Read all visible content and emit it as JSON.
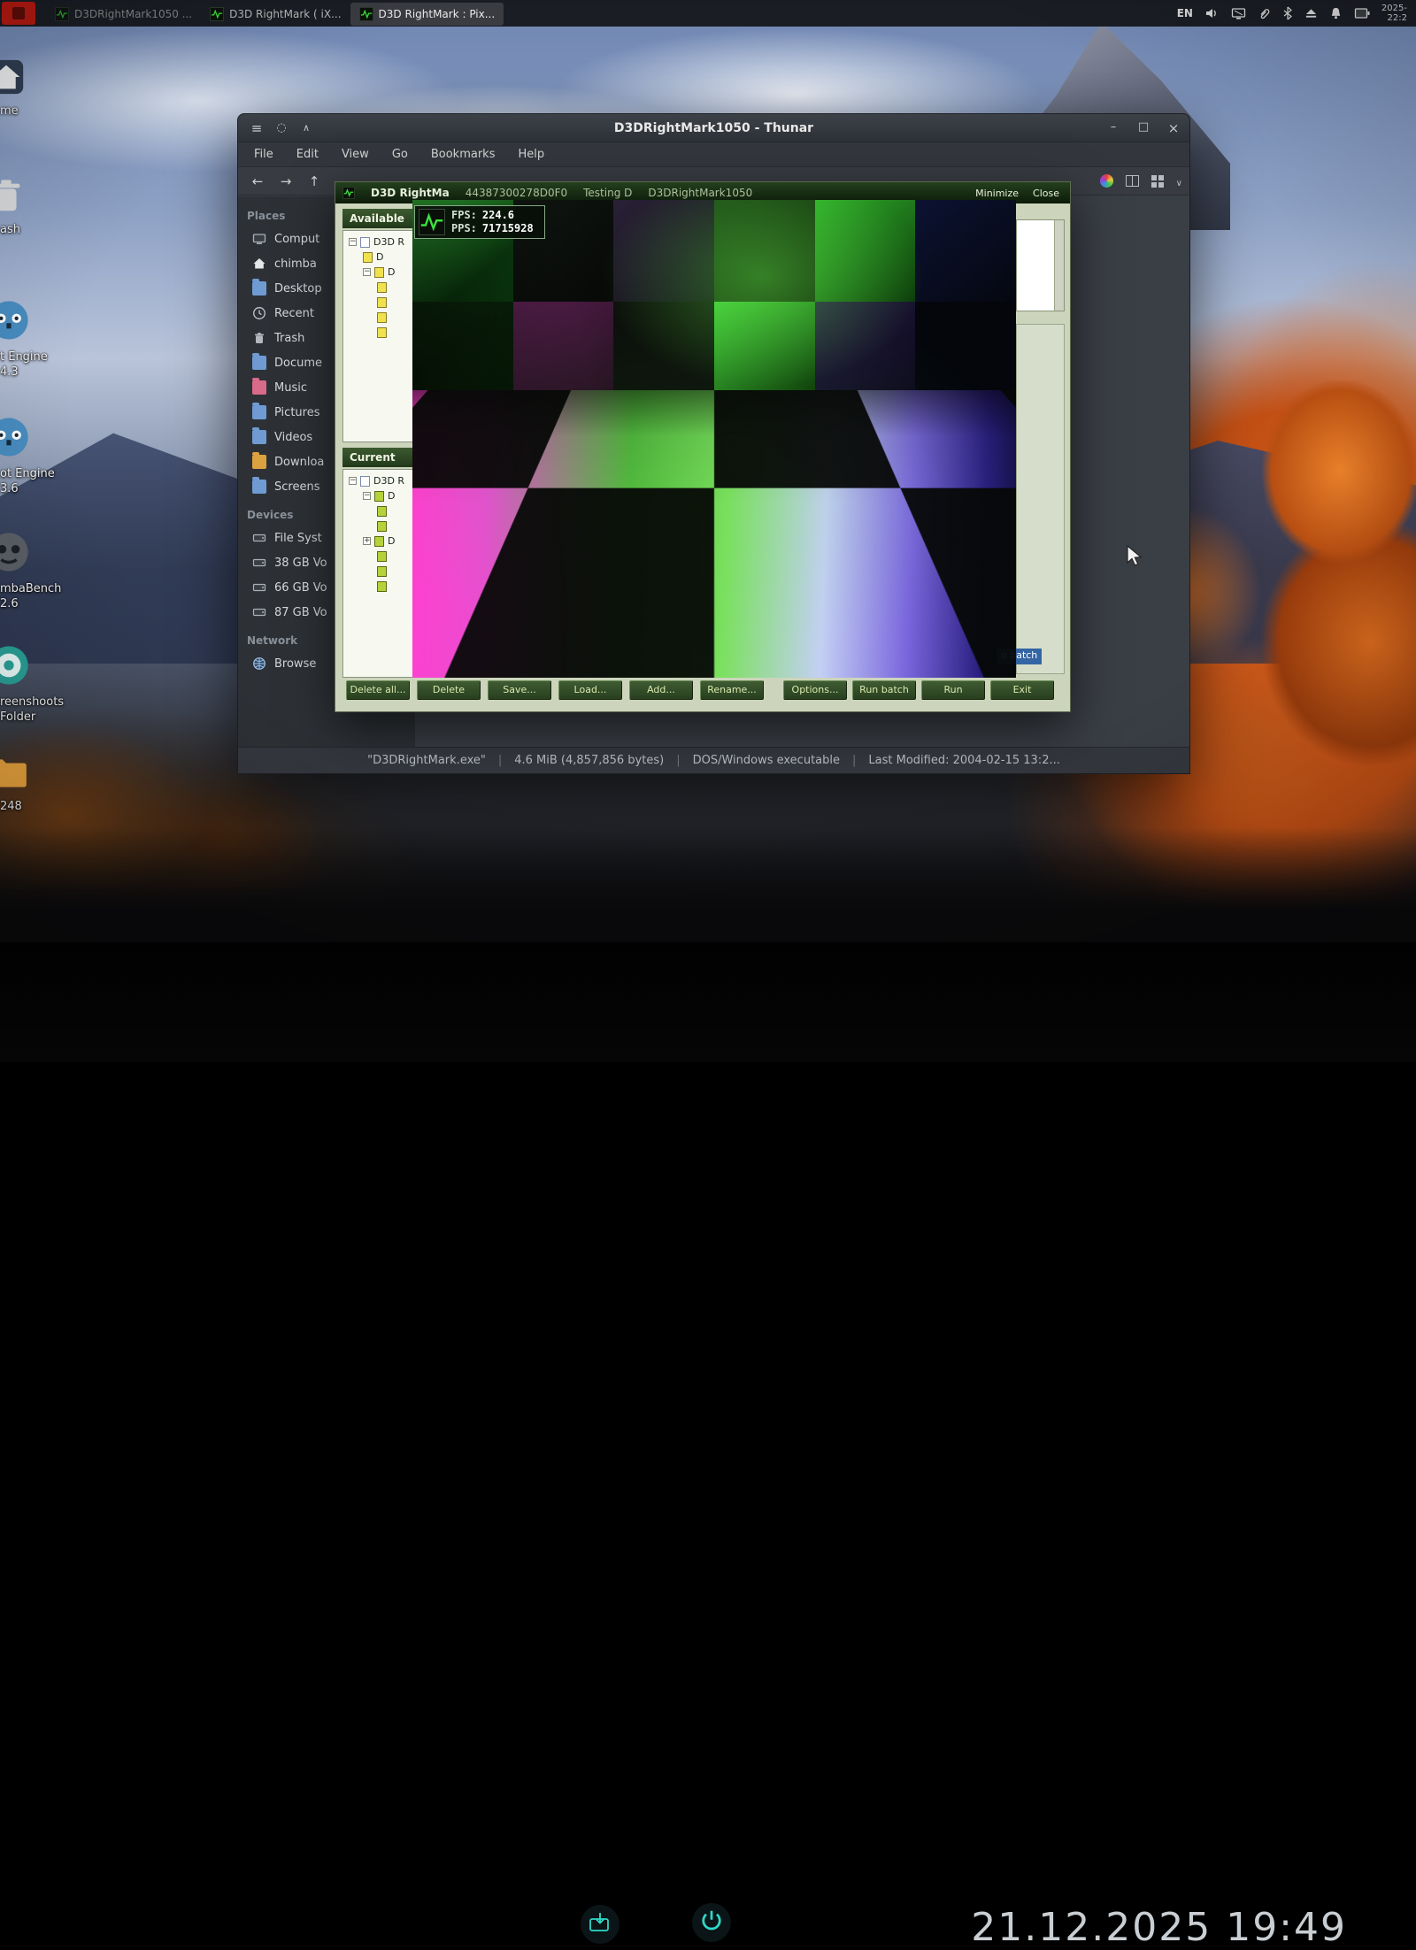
{
  "bezel": {
    "timestamp": "21.12.2025 19:49"
  },
  "taskbar": {
    "windows": [
      {
        "label": "D3DRightMark1050 ..."
      },
      {
        "label": "D3D RightMark ( iX..."
      },
      {
        "label": "D3D RightMark : Pix..."
      }
    ],
    "tray": {
      "language": "EN",
      "clock_date": "2025-",
      "clock_time": "22:2"
    }
  },
  "desktop_icons": [
    {
      "label_lines": [
        "me"
      ]
    },
    {
      "label_lines": [
        "ash"
      ]
    },
    {
      "label_lines": [
        "t Engine",
        "4.3"
      ]
    },
    {
      "label_lines": [
        "ot Engine",
        "3.6"
      ]
    },
    {
      "label_lines": [
        "mbaBench",
        "2.6"
      ]
    },
    {
      "label_lines": [
        "reenshoots",
        "Folder"
      ]
    },
    {
      "label_lines": [
        "248"
      ]
    }
  ],
  "thunar": {
    "title": "D3DRightMark1050 - Thunar",
    "menu": [
      "File",
      "Edit",
      "View",
      "Go",
      "Bookmarks",
      "Help"
    ],
    "sidebar": {
      "places_header": "Places",
      "places": [
        "Comput",
        "chimba",
        "Desktop",
        "Recent",
        "Trash",
        "Docume",
        "Music",
        "Pictures",
        "Videos",
        "Downloa",
        "Screens"
      ],
      "devices_header": "Devices",
      "devices": [
        "File Syst",
        "38 GB Vo",
        "66 GB Vo",
        "87 GB Vo"
      ],
      "network_header": "Network",
      "network": [
        "Browse"
      ]
    },
    "statusbar": [
      "\"D3DRightMark.exe\"",
      "4.6 MiB (4,857,856 bytes)",
      "DOS/Windows executable",
      "Last Modified: 2004-02-15 13:2..."
    ],
    "statusbar_sep": "|"
  },
  "rightmark": {
    "title_fragments": [
      "D3D RightMa",
      "44387300278D0F0",
      "Testing D",
      "D3DRightMark1050"
    ],
    "minimize_label": "Minimize",
    "close_label": "Close",
    "available_header": "Available",
    "current_header": "Current",
    "available_tree": [
      "D3D R",
      "D",
      "D"
    ],
    "current_tree": [
      "D3D R",
      "D",
      "D"
    ],
    "add_to_batch_fragment": "o batch",
    "buttons_left": [
      "Delete all...",
      "Delete",
      "Save...",
      "Load...",
      "Add...",
      "Rename..."
    ],
    "buttons_right": [
      "Options...",
      "Run batch",
      "Run",
      "Exit"
    ],
    "fps_overlay": {
      "fps_label": "FPS:",
      "fps_value": "224.6",
      "pps_label": "PPS:",
      "pps_value": "71715928"
    }
  },
  "colors": {
    "rightmark_bg": "#ccd5bb",
    "rightmark_header_green": "#2c4a24",
    "selection_blue": "#3465a4",
    "fps_pulse_green": "#3ae03a",
    "bezel_icon_teal": "#2fd8c8",
    "autumn_orange": "#d4561a"
  },
  "icons": {
    "taskbar_app_icon": "green-pulse-waveform",
    "tray_icons": [
      "volume",
      "display",
      "paperclip",
      "bluetooth",
      "eject",
      "bell",
      "screen"
    ],
    "bezel_icons": [
      "input-source",
      "power"
    ]
  }
}
